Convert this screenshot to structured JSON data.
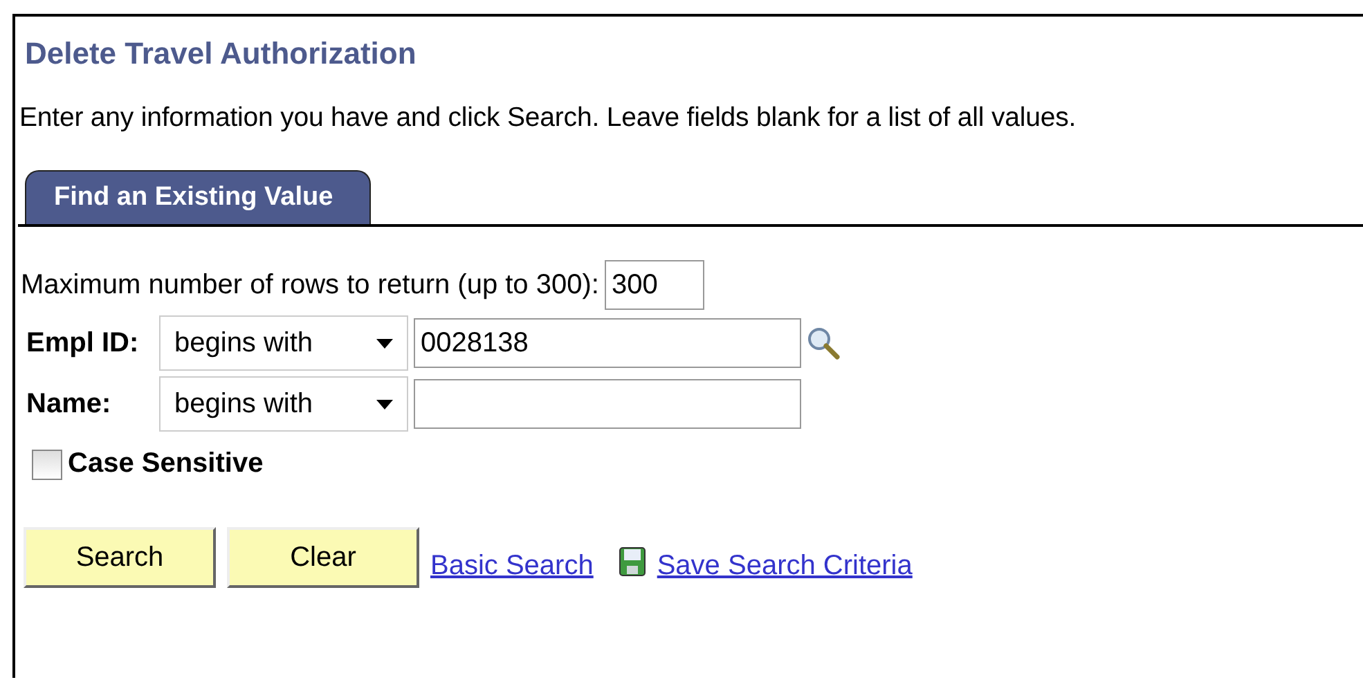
{
  "title": "Delete Travel Authorization",
  "instructions": "Enter any information you have and click Search. Leave fields blank for a list of all values.",
  "tabs": [
    {
      "label": "Find an Existing Value",
      "selected": true
    }
  ],
  "max_rows": {
    "label": "Maximum number of rows to return (up to 300):",
    "value": "300"
  },
  "criteria": [
    {
      "label": "Empl ID:",
      "operator": "begins with",
      "value": "0028138",
      "lookup": true
    },
    {
      "label": "Name:",
      "operator": "begins with",
      "lookup": false
    }
  ],
  "case_sensitive": {
    "label": "Case Sensitive",
    "checked": false
  },
  "buttons": [
    "Search",
    "Clear"
  ],
  "links": [
    {
      "label": "Basic Search",
      "icon": false
    },
    {
      "label": "Save Search Criteria",
      "icon": true
    }
  ]
}
